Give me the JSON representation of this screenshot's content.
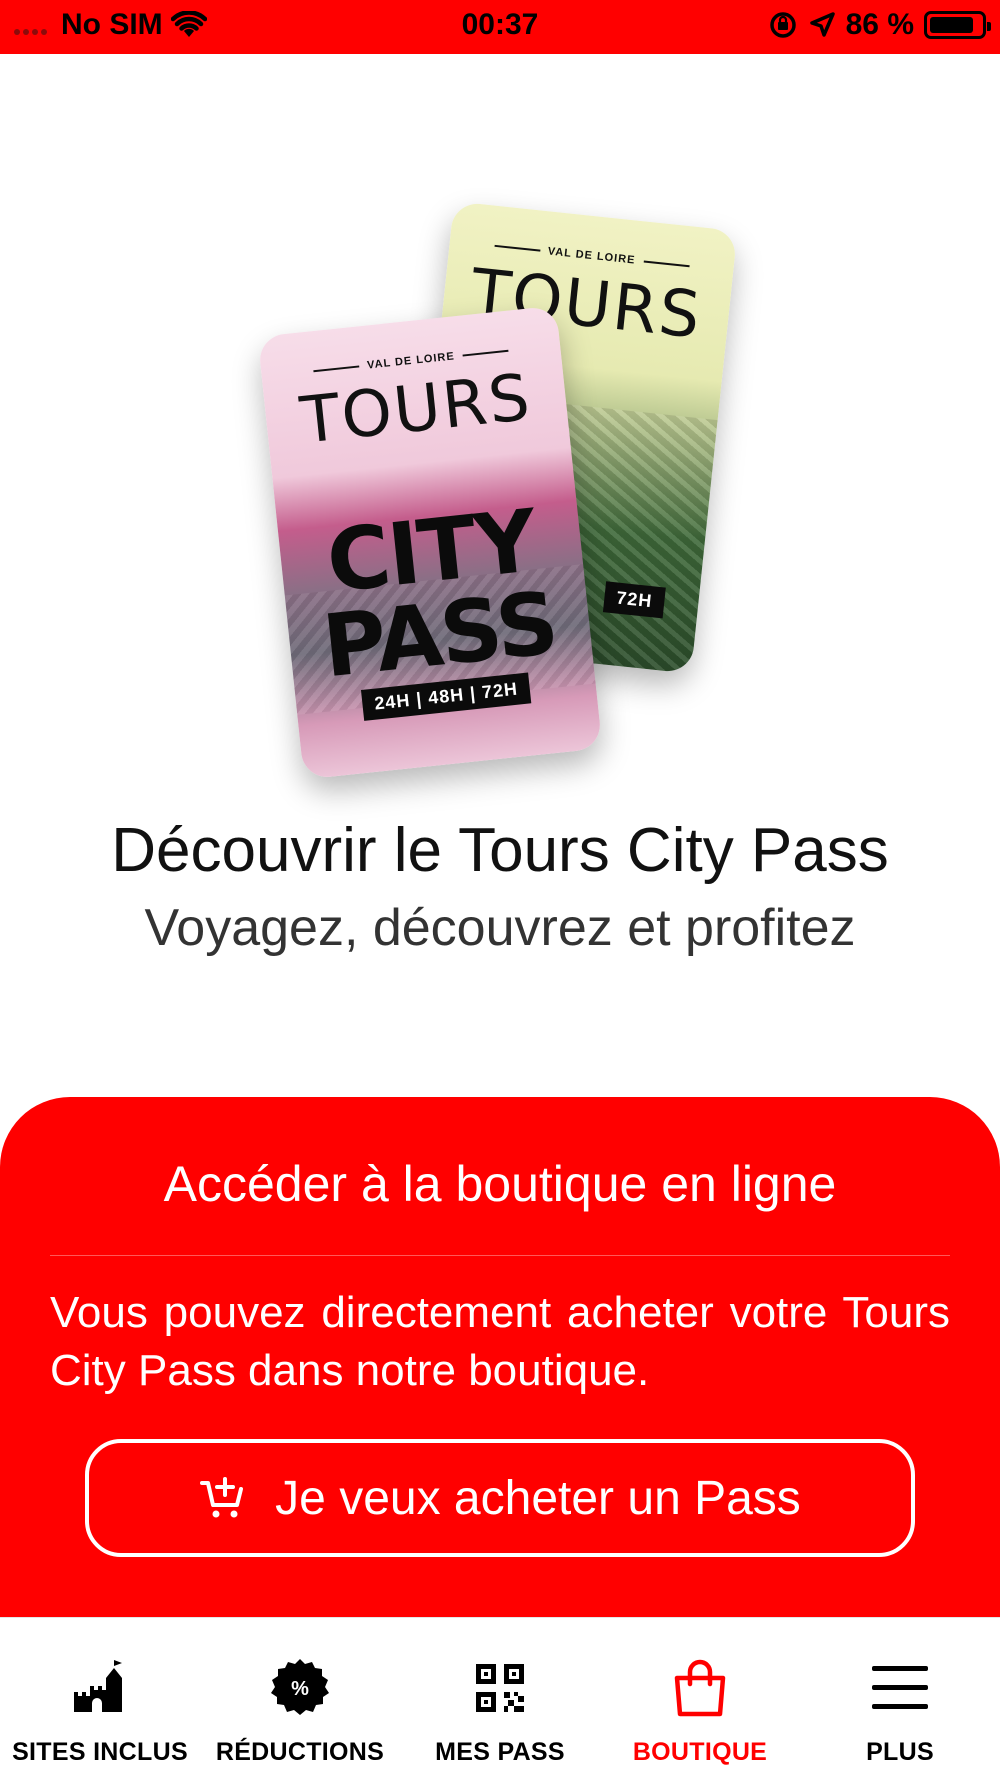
{
  "status_bar": {
    "carrier": "No SIM",
    "time": "00:37",
    "battery_percent": "86 %",
    "battery_level": 0.86,
    "icons": [
      "wifi-icon",
      "orientation-lock-icon",
      "location-arrow-icon",
      "battery-icon"
    ]
  },
  "hero": {
    "card_kicker": "VAL DE LOIRE",
    "card_title": "TOURS",
    "card_line1": "CITY",
    "card_line2": "PASS",
    "card_durations": "24H | 48H | 72H",
    "back_card_durations": "72H"
  },
  "headline": "Découvrir le Tours City Pass",
  "subheadline": "Voyagez, découvrez et profitez",
  "shop": {
    "title": "Accéder à la boutique en ligne",
    "description": "Vous pouvez directement acheter votre Tours City Pass dans notre boutique.",
    "button_label": "Je veux acheter un Pass",
    "button_icon": "cart-add-icon"
  },
  "tabs": [
    {
      "label": "SITES INCLUS",
      "icon": "castle-icon",
      "active": false
    },
    {
      "label": "RÉDUCTIONS",
      "icon": "discount-badge-icon",
      "active": false
    },
    {
      "label": "MES PASS",
      "icon": "qr-code-icon",
      "active": false
    },
    {
      "label": "BOUTIQUE",
      "icon": "shopping-bag-icon",
      "active": true
    },
    {
      "label": "PLUS",
      "icon": "menu-icon",
      "active": false
    }
  ],
  "colors": {
    "accent": "#ff0000",
    "text": "#111111",
    "on_accent": "#ffffff"
  }
}
